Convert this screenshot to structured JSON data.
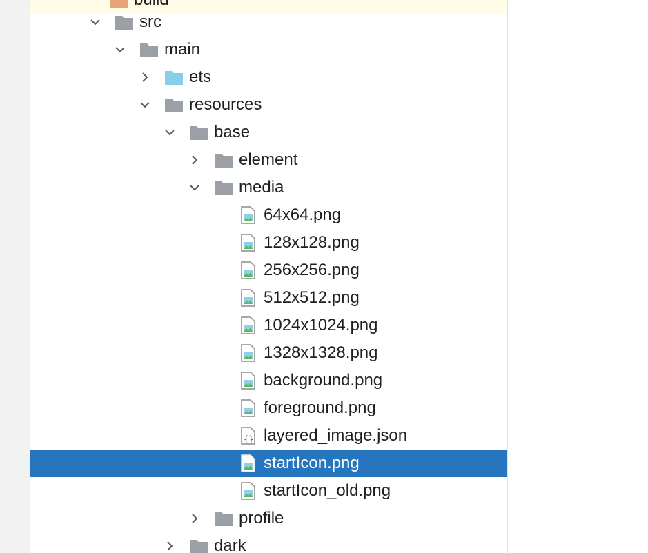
{
  "tree": {
    "build_label": "build",
    "src_label": "src",
    "main_label": "main",
    "ets_label": "ets",
    "resources_label": "resources",
    "base_label": "base",
    "element_label": "element",
    "media_label": "media",
    "files": [
      "64x64.png",
      "128x128.png",
      "256x256.png",
      "512x512.png",
      "1024x1024.png",
      "1328x1328.png",
      "background.png",
      "foreground.png",
      "layered_image.json",
      "startIcon.png",
      "startIcon_old.png"
    ],
    "profile_label": "profile",
    "dark_label": "dark",
    "selected_item": "startIcon.png"
  },
  "colors": {
    "selection": "#2675bf",
    "folder_gray": "#9aa0a6",
    "folder_blue": "#87cfe8"
  },
  "icons": {
    "folder": "folder-icon",
    "source_folder": "source-folder-icon",
    "image_file": "image-file-icon",
    "json_file": "json-file-icon"
  }
}
